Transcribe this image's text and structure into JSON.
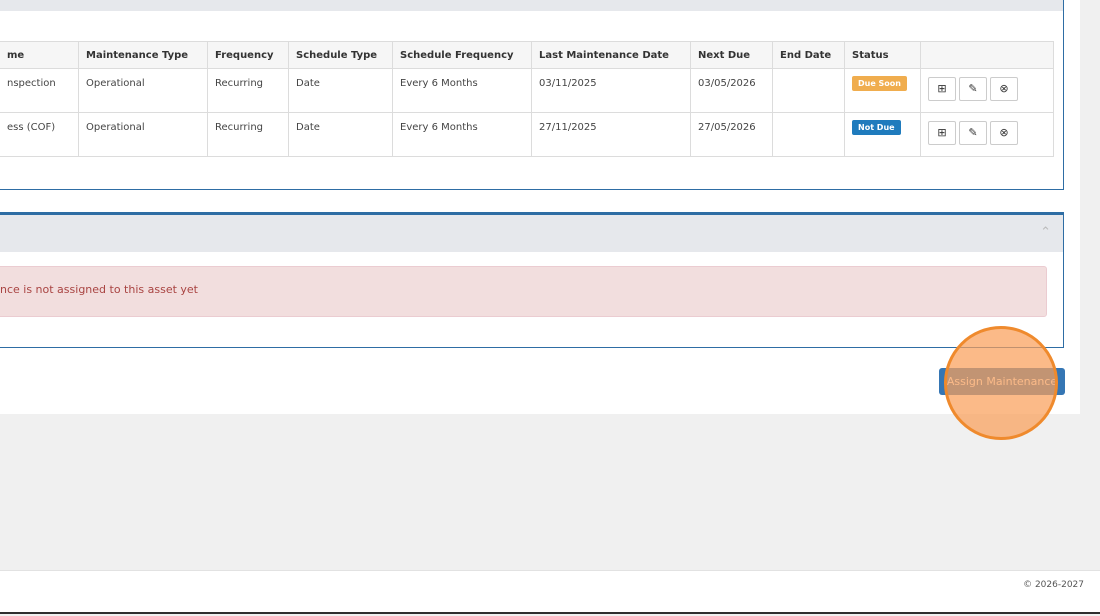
{
  "table": {
    "headers": [
      "me",
      "Maintenance Type",
      "Frequency",
      "Schedule Type",
      "Schedule Frequency",
      "Last Maintenance Date",
      "Next Due",
      "End Date",
      "Status",
      ""
    ],
    "rows": [
      {
        "name": "nspection",
        "type": "Operational",
        "frequency": "Recurring",
        "schedule_type": "Date",
        "schedule_frequency": "Every 6 Months",
        "last_date": "03/11/2025",
        "next_due": "03/05/2026",
        "end_date": "",
        "status": "Due Soon",
        "status_color": "#f0ad4e"
      },
      {
        "name": "ess (COF)",
        "type": "Operational",
        "frequency": "Recurring",
        "schedule_type": "Date",
        "schedule_frequency": "Every 6 Months",
        "last_date": "27/11/2025",
        "next_due": "27/05/2026",
        "end_date": "",
        "status": "Not Due",
        "status_color": "#1f7bbd"
      }
    ],
    "row_actions": [
      "plus-square-icon",
      "edit-icon",
      "remove-icon"
    ]
  },
  "alert": {
    "message": "ance is not assigned to this asset yet."
  },
  "assign_button": {
    "label": "Assign Maintenance"
  },
  "footer": {
    "copyright": "© 2026-2027"
  },
  "colors": {
    "primary": "#3576b4",
    "panel_border": "#2e6da4",
    "danger_bg": "#f2dede",
    "danger_text": "#a94442",
    "cursor_highlight": "#ef8a2d"
  }
}
